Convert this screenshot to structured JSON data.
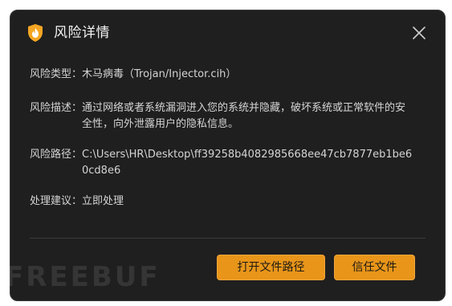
{
  "dialog": {
    "title": "风险详情",
    "icon": "shield-flame-icon",
    "accent_color": "#e8951a"
  },
  "details": {
    "type": {
      "label": "风险类型：",
      "value": "木马病毒（Trojan/Injector.cih）"
    },
    "description": {
      "label": "风险描述：",
      "value": "通过网络或者系统漏洞进入您的系统并隐藏，破坏系统或正常软件的安全性，向外泄露用户的隐私信息。"
    },
    "path": {
      "label": "风险路径：",
      "value": "C:\\Users\\HR\\Desktop\\ff39258b4082985668ee47cb7877eb1be60cd8e6"
    },
    "advice": {
      "label": "处理建议：",
      "value": "立即处理"
    }
  },
  "buttons": {
    "open_path": "打开文件路径",
    "trust_file": "信任文件"
  },
  "watermark": "FREEBUF"
}
